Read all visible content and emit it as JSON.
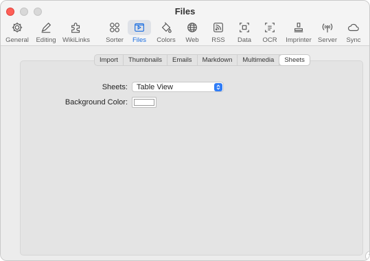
{
  "window": {
    "title": "Files"
  },
  "toolbar": {
    "items": [
      {
        "label": "General",
        "icon": "gear-icon"
      },
      {
        "label": "Editing",
        "icon": "pencil-icon"
      },
      {
        "label": "WikiLinks",
        "icon": "puzzle-icon"
      },
      {
        "label": "Sorter",
        "icon": "circles-icon"
      },
      {
        "label": "Files",
        "icon": "files-icon",
        "active": true
      },
      {
        "label": "Colors",
        "icon": "paint-bucket-icon"
      },
      {
        "label": "Web",
        "icon": "globe-icon"
      },
      {
        "label": "RSS",
        "icon": "rss-icon"
      },
      {
        "label": "Data",
        "icon": "data-icon"
      },
      {
        "label": "OCR",
        "icon": "ocr-icon"
      },
      {
        "label": "Imprinter",
        "icon": "stamp-icon"
      },
      {
        "label": "Server",
        "icon": "broadcast-icon"
      },
      {
        "label": "Sync",
        "icon": "cloud-icon"
      }
    ]
  },
  "tabs": [
    "Import",
    "Thumbnails",
    "Emails",
    "Markdown",
    "Multimedia",
    "Sheets"
  ],
  "active_tab": "Sheets",
  "form": {
    "sheets_label": "Sheets:",
    "sheets_value": "Table View",
    "bg_label": "Background Color:",
    "bg_color": "#ffffff"
  },
  "help": {
    "label": "?"
  },
  "colors": {
    "accent": "#1a6de0",
    "select_accent": "#2f7cf6",
    "close": "#fe5f57"
  }
}
